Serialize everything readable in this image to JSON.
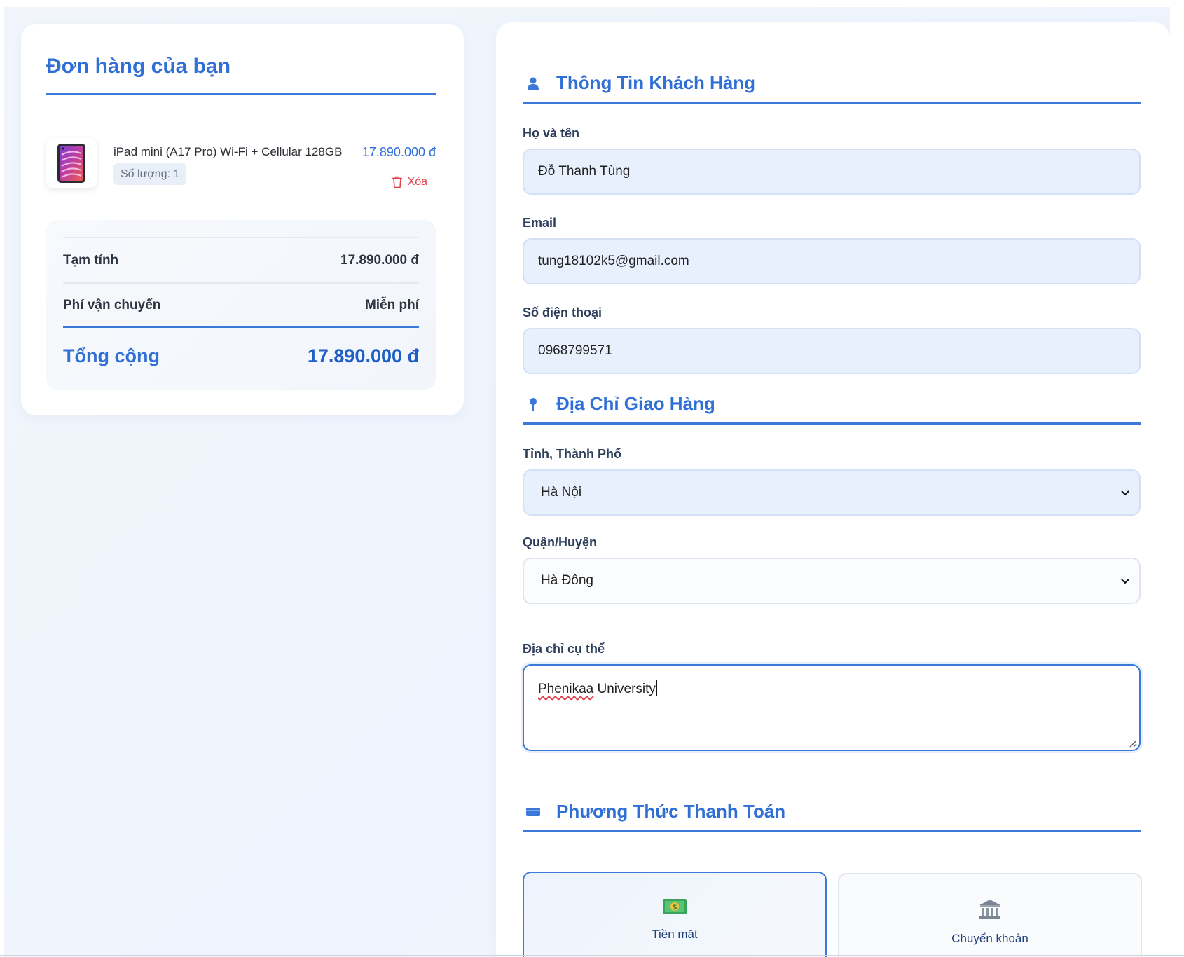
{
  "order": {
    "title": "Đơn hàng của bạn",
    "item": {
      "name": "iPad mini (A17 Pro) Wi-Fi + Cellular 128GB",
      "quantity_label": "Số lượng: 1",
      "price": "17.890.000 đ",
      "delete_label": "Xóa"
    },
    "summary": {
      "subtotal_label": "Tạm tính",
      "subtotal_value": "17.890.000 đ",
      "shipping_label": "Phí vận chuyển",
      "shipping_value": "Miễn phí",
      "total_label": "Tổng cộng",
      "total_value": "17.890.000 đ"
    }
  },
  "customer": {
    "section_title": "Thông Tin Khách Hàng",
    "name_label": "Họ và tên",
    "name_value": "Đỗ Thanh Tùng",
    "email_label": "Email",
    "email_value": "tung18102k5@gmail.com",
    "phone_label": "Số điện thoại",
    "phone_value": "0968799571"
  },
  "shipping": {
    "section_title": "Địa Chỉ Giao Hàng",
    "city_label": "Tỉnh, Thành Phố",
    "city_value": "Hà Nội",
    "district_label": "Quận/Huyện",
    "district_value": "Hà Đông",
    "address_label": "Địa chỉ cụ thể",
    "address_value_word1": "Phenikaa",
    "address_value_word2": " University"
  },
  "payment": {
    "section_title": "Phương Thức Thanh Toán",
    "options": [
      {
        "label": "Tiền mặt",
        "icon": "cash-icon"
      },
      {
        "label": "Chuyển khoản",
        "icon": "bank-icon"
      }
    ],
    "selected": "Tiền mặt"
  },
  "colors": {
    "accent": "#2f6fd6",
    "danger": "#e0414b",
    "field_bg": "#e8f0fd",
    "page_bg": "#eef4fd"
  }
}
